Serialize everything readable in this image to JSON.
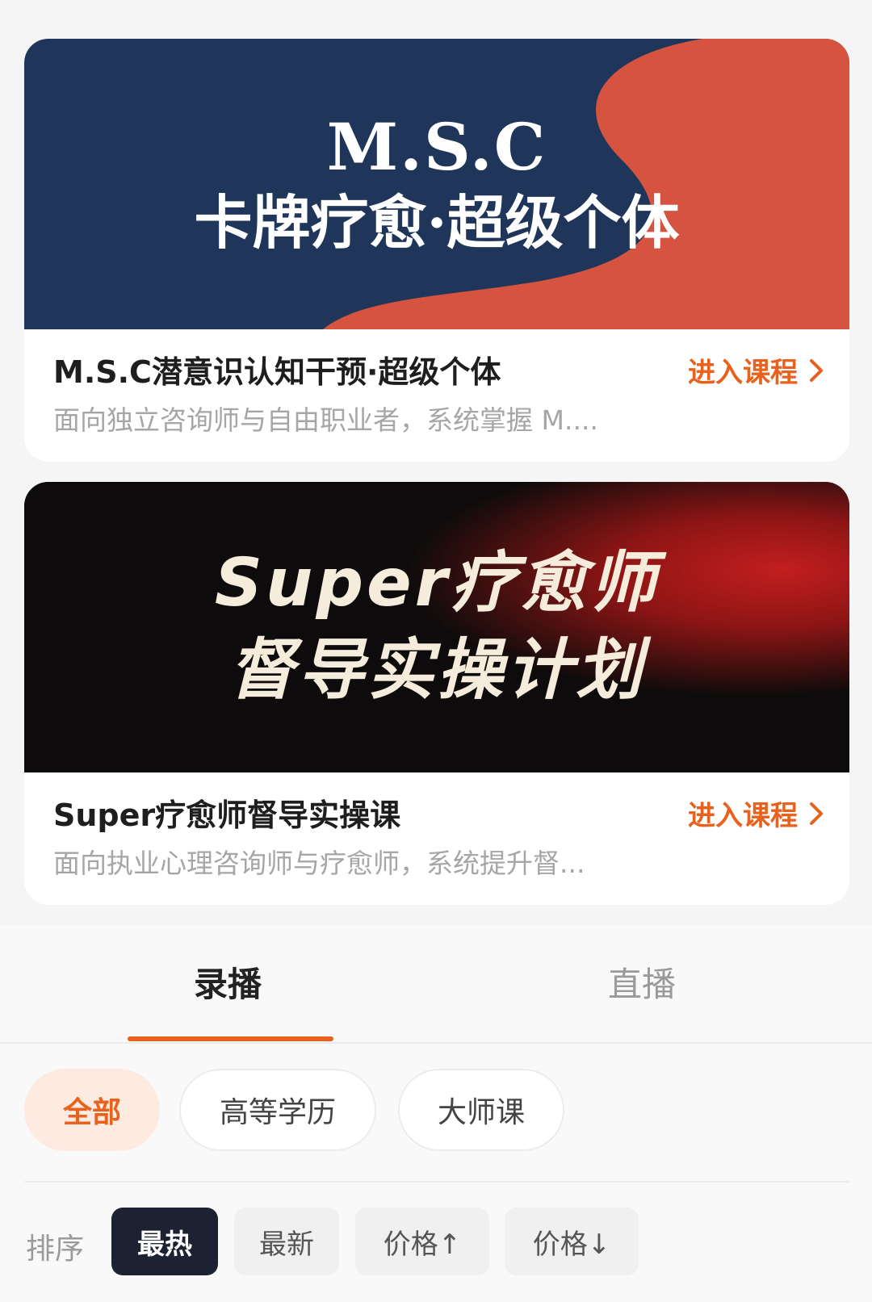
{
  "courses": [
    {
      "banner_line1": "M.S.C",
      "banner_line2": "卡牌疗愈·超级个体",
      "title": "M.S.C潜意识认知干预·超级个体",
      "description": "面向独立咨询师与自由职业者，系统掌握 M....",
      "link_label": "进入课程"
    },
    {
      "banner_line1": "Super疗愈师",
      "banner_line2": "督导实操计划",
      "title": "Super疗愈师督导实操课",
      "description": "面向执业心理咨询师与疗愈师，系统提升督...",
      "link_label": "进入课程"
    }
  ],
  "tabs": [
    "录播",
    "直播"
  ],
  "categories": [
    "全部",
    "高等学历",
    "大师课"
  ],
  "sort": {
    "label": "排序",
    "options": [
      "最热",
      "最新",
      "价格↑",
      "价格↓"
    ]
  },
  "colors": {
    "accent": "#e8611d",
    "banner1_navy": "#1f355a",
    "banner1_red": "#d5533f",
    "banner2_dark": "#0d0b0b",
    "banner2_red": "#b81b1b",
    "sort_active": "#1c2232"
  },
  "icons": {
    "link_arrow": "chevron-right-icon"
  }
}
